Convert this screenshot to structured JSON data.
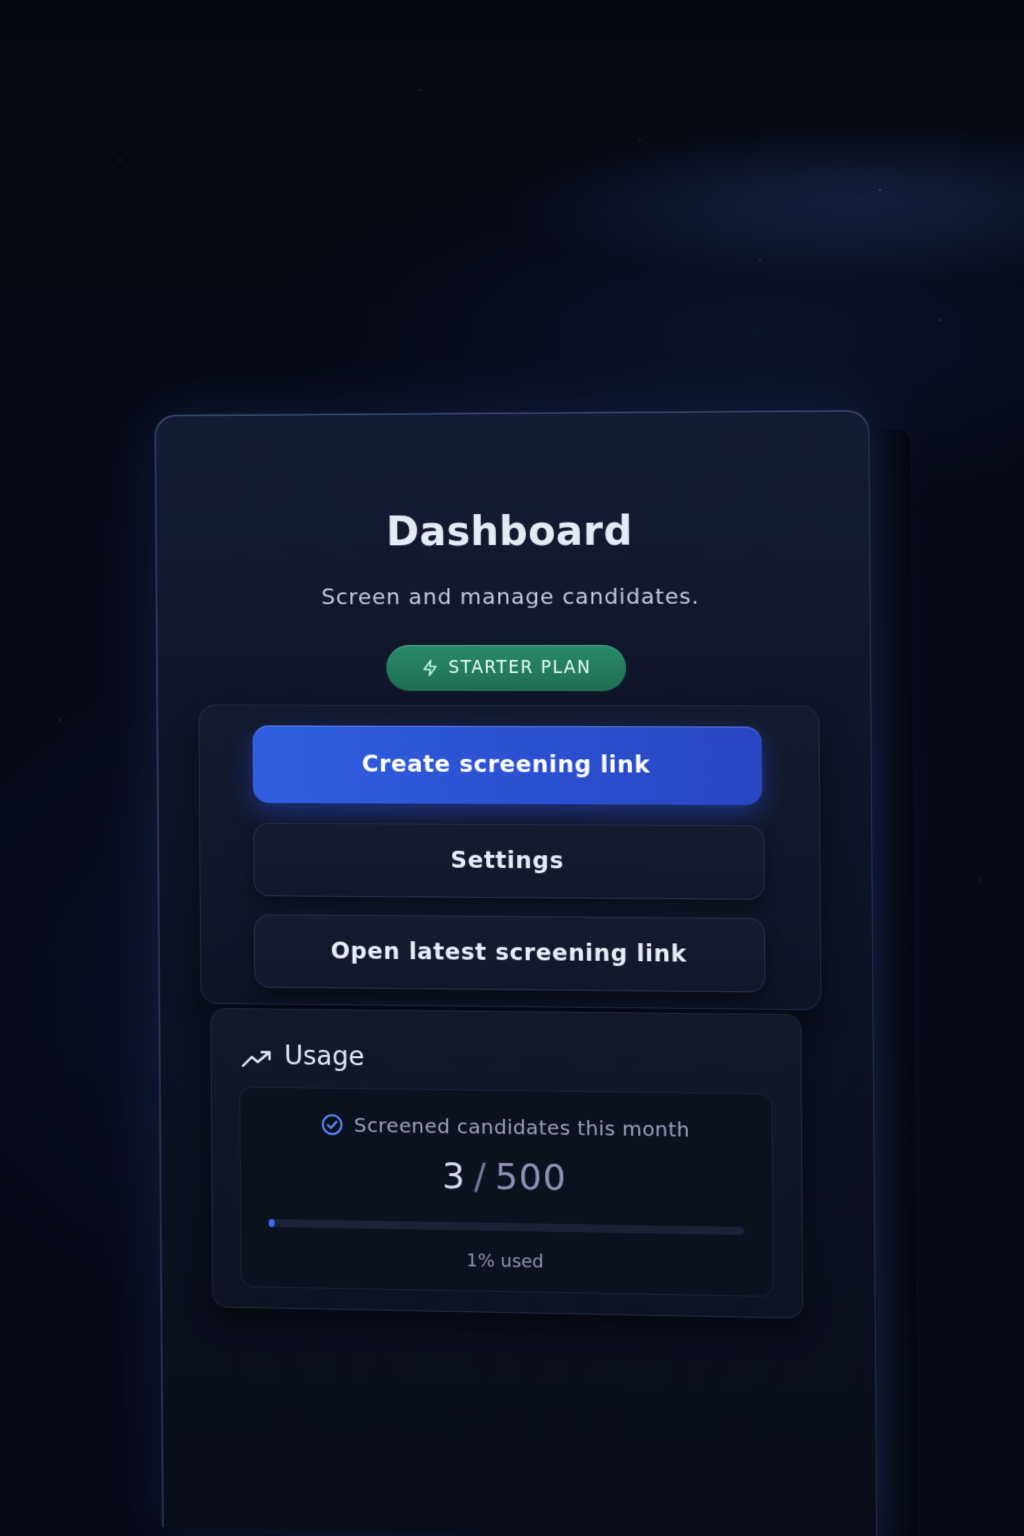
{
  "header": {
    "title": "Dashboard",
    "subtitle": "Screen and manage candidates.",
    "plan_badge": "STARTER PLAN"
  },
  "actions": {
    "create_link": "Create screening link",
    "settings": "Settings",
    "open_latest": "Open latest screening link"
  },
  "usage": {
    "title": "Usage",
    "metric_label": "Screened candidates this month",
    "used": "3",
    "separator": "/",
    "total": "500",
    "progress_fraction": 0.01,
    "progress_text": "1% used"
  },
  "icons": {
    "plan": "bolt-icon",
    "usage": "trend-up-icon",
    "metric": "check-circle-icon"
  },
  "colors": {
    "primary": "#2f5fe0",
    "badge": "#2a8a68",
    "background": "#05070e"
  }
}
